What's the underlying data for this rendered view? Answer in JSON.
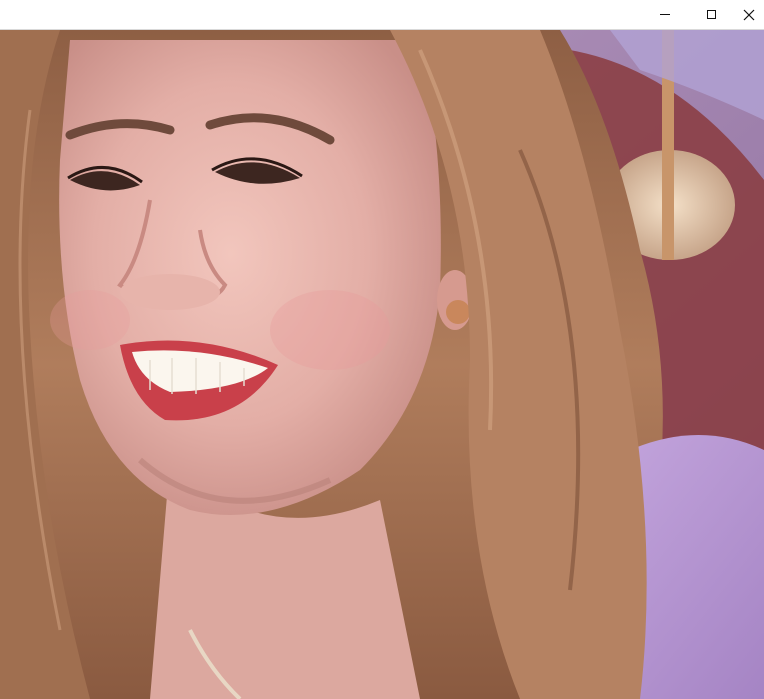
{
  "window": {
    "title": "",
    "controls": {
      "minimize": "minimize-icon",
      "maximize": "maximize-icon",
      "close": "close-icon"
    }
  },
  "viewer": {
    "image_subject": "",
    "colors": {
      "background": "#a78cb5",
      "hair": "#a0704f",
      "skin": "#e8b8b0",
      "lips": "#d4484f",
      "sweater": "#b898d4"
    }
  }
}
